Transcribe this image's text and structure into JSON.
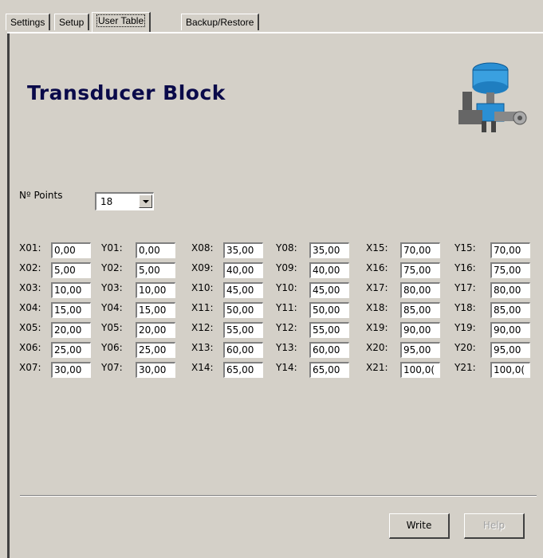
{
  "tabs": [
    "Settings",
    "Setup",
    "User Table",
    "Backup/Restore"
  ],
  "active_tab": "User Table",
  "title": "Transducer Block",
  "device_image": "valve-positioner-icon",
  "points": {
    "label": "Nº Points",
    "value": "18"
  },
  "table": {
    "columns": [
      [
        [
          "X01:",
          "0,00"
        ],
        [
          "X02:",
          "5,00"
        ],
        [
          "X03:",
          "10,00"
        ],
        [
          "X04:",
          "15,00"
        ],
        [
          "X05:",
          "20,00"
        ],
        [
          "X06:",
          "25,00"
        ],
        [
          "X07:",
          "30,00"
        ]
      ],
      [
        [
          "Y01:",
          "0,00"
        ],
        [
          "Y02:",
          "5,00"
        ],
        [
          "Y03:",
          "10,00"
        ],
        [
          "Y04:",
          "15,00"
        ],
        [
          "Y05:",
          "20,00"
        ],
        [
          "Y06:",
          "25,00"
        ],
        [
          "Y07:",
          "30,00"
        ]
      ],
      [
        [
          "X08:",
          "35,00"
        ],
        [
          "X09:",
          "40,00"
        ],
        [
          "X10:",
          "45,00"
        ],
        [
          "X11:",
          "50,00"
        ],
        [
          "X12:",
          "55,00"
        ],
        [
          "X13:",
          "60,00"
        ],
        [
          "X14:",
          "65,00"
        ]
      ],
      [
        [
          "Y08:",
          "35,00"
        ],
        [
          "Y09:",
          "40,00"
        ],
        [
          "Y10:",
          "45,00"
        ],
        [
          "Y11:",
          "50,00"
        ],
        [
          "Y12:",
          "55,00"
        ],
        [
          "Y13:",
          "60,00"
        ],
        [
          "Y14:",
          "65,00"
        ]
      ],
      [
        [
          "X15:",
          "70,00"
        ],
        [
          "X16:",
          "75,00"
        ],
        [
          "X17:",
          "80,00"
        ],
        [
          "X18:",
          "85,00"
        ],
        [
          "X19:",
          "90,00"
        ],
        [
          "X20:",
          "95,00"
        ],
        [
          "X21:",
          "100,0("
        ]
      ],
      [
        [
          "Y15:",
          "70,00"
        ],
        [
          "Y16:",
          "75,00"
        ],
        [
          "Y17:",
          "80,00"
        ],
        [
          "Y18:",
          "85,00"
        ],
        [
          "Y19:",
          "90,00"
        ],
        [
          "Y20:",
          "95,00"
        ],
        [
          "Y21:",
          "100,0("
        ]
      ]
    ]
  },
  "buttons": {
    "write": "Write",
    "help": "Help"
  }
}
